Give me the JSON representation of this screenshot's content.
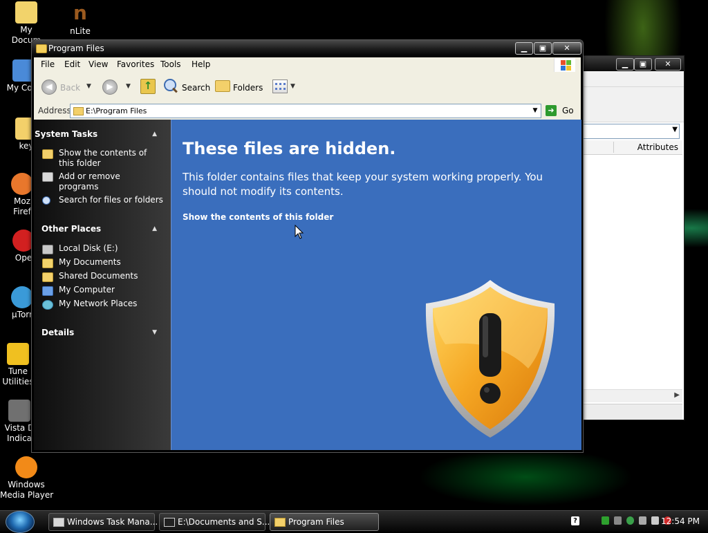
{
  "desktop": {
    "icons": [
      {
        "label": "My\nDocum",
        "color": "#f2d36b"
      },
      {
        "label": "nLite",
        "color": "#9b5a1f"
      },
      {
        "label": "My Com",
        "color": "#4a8ad8"
      },
      {
        "label": "key",
        "color": "#f3d06a"
      },
      {
        "label": "Moz\nFiref",
        "color": "#e8772c"
      },
      {
        "label": "Ope",
        "color": "#d22020"
      },
      {
        "label": "µTorr",
        "color": "#3a9ad8"
      },
      {
        "label": "Tune\nUtilities",
        "color": "#f0c020"
      },
      {
        "label": "Vista D\nIndica",
        "color": "#707070"
      },
      {
        "label": "Windows\nMedia Player",
        "color": "#f28a18"
      }
    ]
  },
  "background_window": {
    "close_label": "✕",
    "column_attributes": "Attributes"
  },
  "window": {
    "title": "Program Files",
    "menu": [
      "File",
      "Edit",
      "View",
      "Favorites",
      "Tools",
      "Help"
    ],
    "toolbar": {
      "back_label": "Back",
      "search_label": "Search",
      "folders_label": "Folders"
    },
    "address": {
      "label": "Address",
      "value": "E:\\Program Files",
      "go_label": "Go"
    }
  },
  "task_pane": {
    "system_tasks": {
      "title": "System Tasks",
      "items": [
        "Show the contents of\nthis folder",
        "Add or remove\nprograms",
        "Search for files or folders"
      ]
    },
    "other_places": {
      "title": "Other Places",
      "items": [
        "Local Disk (E:)",
        "My Documents",
        "Shared Documents",
        "My Computer",
        "My Network Places"
      ]
    },
    "details": {
      "title": "Details"
    }
  },
  "content": {
    "heading": "These files are hidden.",
    "message": "This folder contains files that keep your system working properly. You should not modify its contents.",
    "link": "Show the contents of this folder"
  },
  "taskbar": {
    "items": [
      {
        "label": "Windows Task Mana..."
      },
      {
        "label": "E:\\Documents and S..."
      },
      {
        "label": "Program Files"
      }
    ],
    "clock": "12:54 PM"
  },
  "colors": {
    "content_bg": "#3a6ebd",
    "shield_orange": "#f5a623"
  }
}
